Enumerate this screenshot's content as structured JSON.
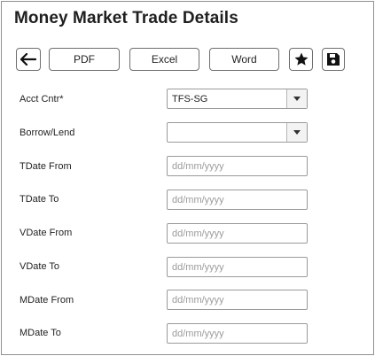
{
  "title": "Money Market Trade Details",
  "toolbar": {
    "back_icon": "arrow-left-icon",
    "pdf_label": "PDF",
    "excel_label": "Excel",
    "word_label": "Word",
    "favorite_icon": "star-icon",
    "save_icon": "floppy-disk-icon"
  },
  "form": {
    "acct_cntr": {
      "label": "Acct Cntr*",
      "value": "TFS-SG"
    },
    "borrow_lend": {
      "label": "Borrow/Lend",
      "value": ""
    },
    "tdate_from": {
      "label": "TDate From",
      "placeholder": "dd/mm/yyyy"
    },
    "tdate_to": {
      "label": "TDate To",
      "placeholder": "dd/mm/yyyy"
    },
    "vdate_from": {
      "label": "VDate From",
      "placeholder": "dd/mm/yyyy"
    },
    "vdate_to": {
      "label": "VDate To",
      "placeholder": "dd/mm/yyyy"
    },
    "mdate_from": {
      "label": "MDate From",
      "placeholder": "dd/mm/yyyy"
    },
    "mdate_to": {
      "label": "MDate To",
      "placeholder": "dd/mm/yyyy"
    }
  }
}
